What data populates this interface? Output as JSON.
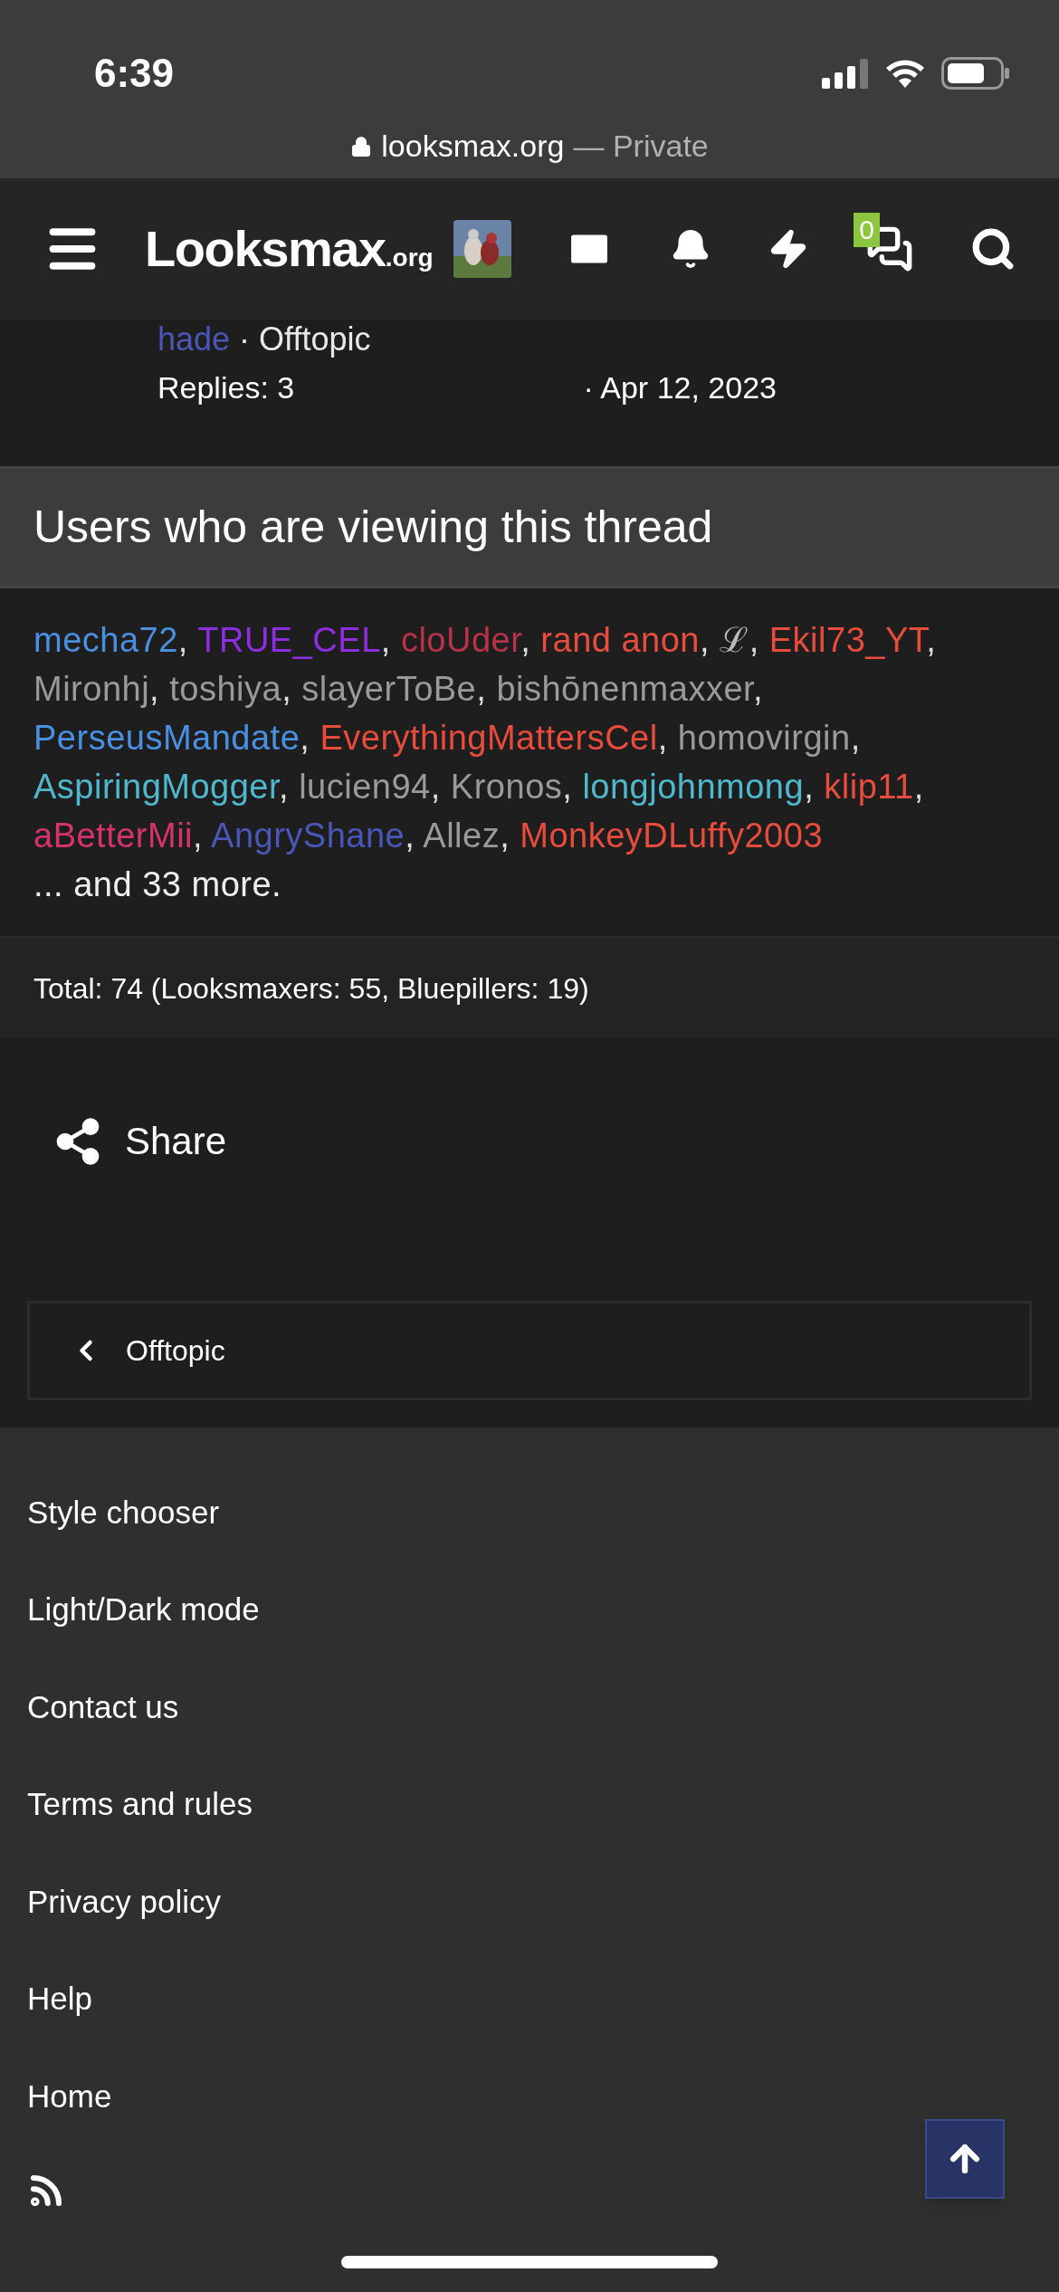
{
  "status_bar": {
    "time": "6:39"
  },
  "browser": {
    "domain": "looksmax.org",
    "mode": "— Private"
  },
  "header": {
    "logo": "Looksmax",
    "logo_suffix": ".org",
    "chat_badge": "0"
  },
  "thread_row": {
    "author": "hade",
    "forum": "· Offtopic",
    "replies": "Replies: 3",
    "date": "· Apr 12, 2023"
  },
  "viewers": {
    "title": "Users who are viewing this thread",
    "separator": ", ",
    "users": [
      {
        "name": "mecha72",
        "color": "#4a90e2"
      },
      {
        "name": "TRUE_CEL",
        "color": "#8e2de2"
      },
      {
        "name": "cloUder",
        "color": "#b8324a"
      },
      {
        "name": "rand anon",
        "color": "#e74c3c"
      },
      {
        "name": "ℒ",
        "color": "#bbbbbb"
      },
      {
        "name": "Ekil73_YT",
        "color": "#e74c3c"
      },
      {
        "name": "Mironhj",
        "color": "#9a9a9a"
      },
      {
        "name": "toshiya",
        "color": "#9a9a9a"
      },
      {
        "name": "slayerToBe",
        "color": "#9a9a9a"
      },
      {
        "name": "bishōnenmaxxer",
        "color": "#9a9a9a"
      },
      {
        "name": "PerseusMandate",
        "color": "#4a90e2"
      },
      {
        "name": "EverythingMattersCel",
        "color": "#e74c3c"
      },
      {
        "name": "homovirgin",
        "color": "#9a9a9a"
      },
      {
        "name": "AspiringMogger",
        "color": "#4fb8cc"
      },
      {
        "name": "lucien94",
        "color": "#9a9a9a"
      },
      {
        "name": "Kronos",
        "color": "#9a9a9a"
      },
      {
        "name": "longjohnmong",
        "color": "#4fb8cc"
      },
      {
        "name": "klip11",
        "color": "#e74c3c"
      },
      {
        "name": "aBetterMii",
        "color": "#d6336c"
      },
      {
        "name": "AngryShane",
        "color": "#4a56b8"
      },
      {
        "name": "Allez",
        "color": "#9a9a9a"
      },
      {
        "name": "MonkeyDLuffy2003",
        "color": "#e74c3c"
      }
    ],
    "more": "... and 33 more.",
    "total": "Total: 74 (Looksmaxers: 55, Bluepillers: 19)"
  },
  "share": {
    "label": "Share"
  },
  "breadcrumb": {
    "label": "Offtopic"
  },
  "footer": {
    "links": [
      "Style chooser",
      "Light/Dark mode",
      "Contact us",
      "Terms and rules",
      "Privacy policy",
      "Help",
      "Home"
    ]
  }
}
